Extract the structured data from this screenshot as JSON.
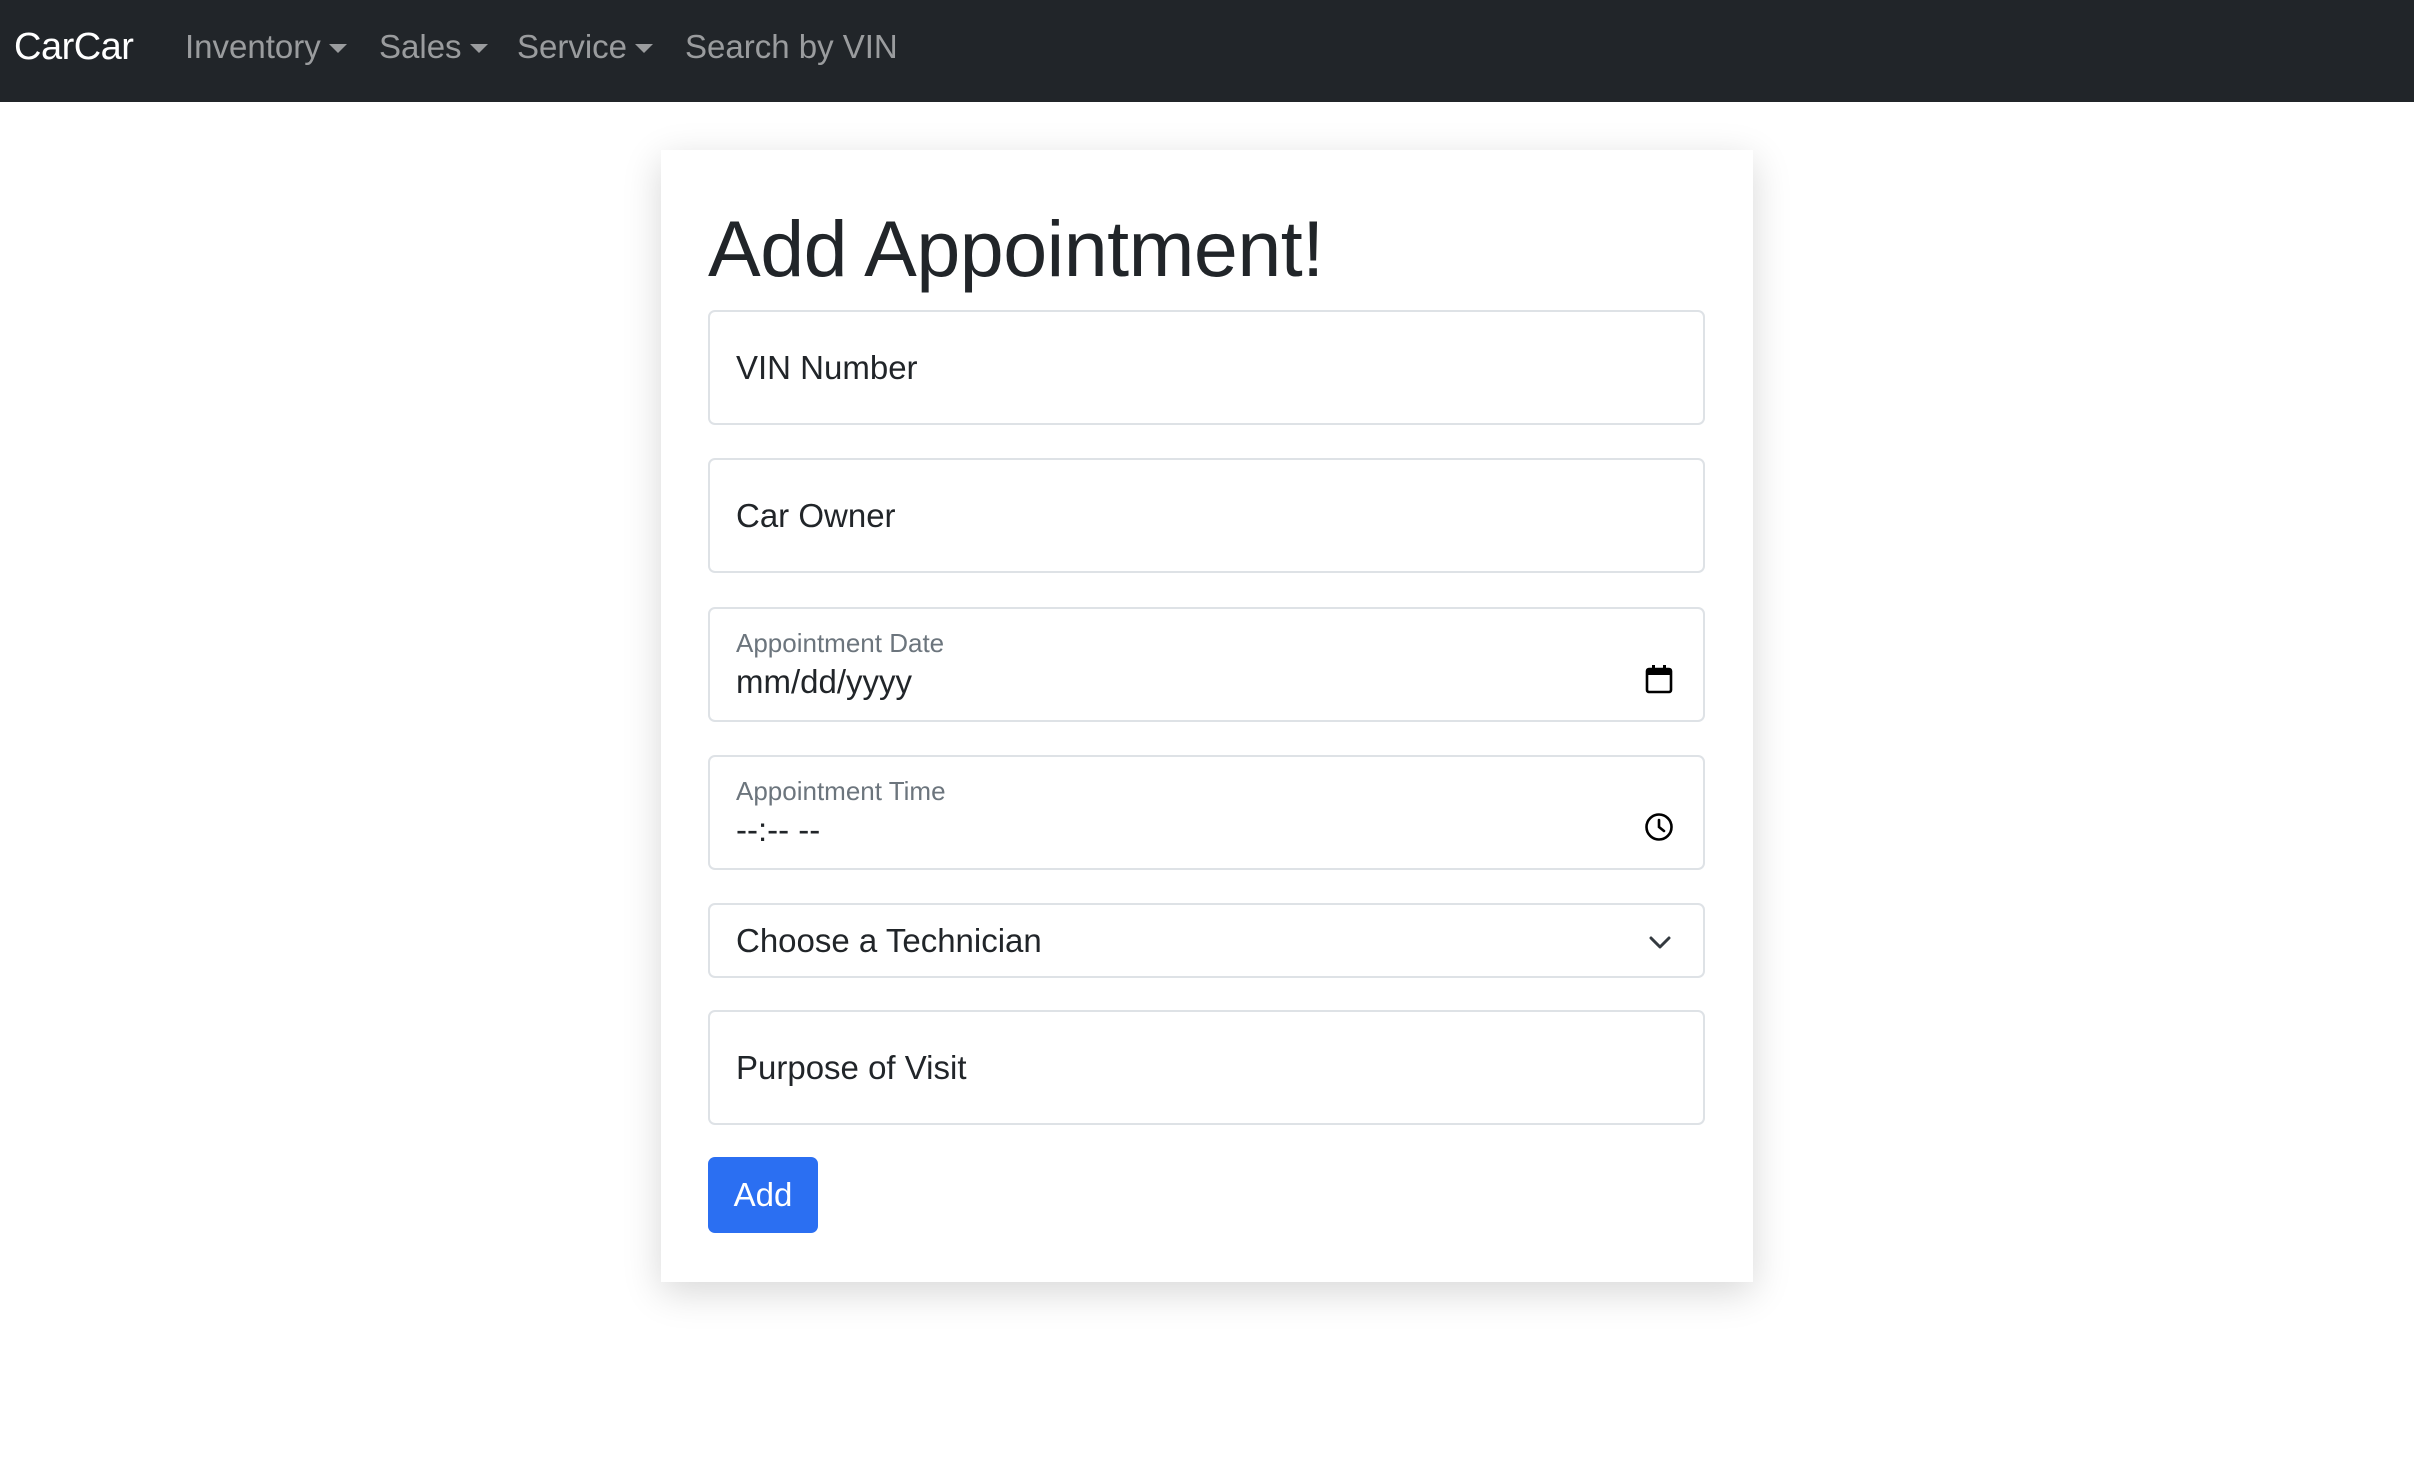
{
  "navbar": {
    "brand": "CarCar",
    "items": [
      {
        "label": "Inventory",
        "dropdown": true
      },
      {
        "label": "Sales",
        "dropdown": true
      },
      {
        "label": "Service",
        "dropdown": true
      },
      {
        "label": "Search by VIN",
        "dropdown": false
      }
    ]
  },
  "form": {
    "title": "Add Appointment!",
    "vin": {
      "placeholder": "VIN Number",
      "value": ""
    },
    "owner": {
      "placeholder": "Car Owner",
      "value": ""
    },
    "date": {
      "label": "Appointment Date",
      "value": "mm/dd/yyyy",
      "icon": "calendar-icon"
    },
    "time": {
      "label": "Appointment Time",
      "value": "--:-- --",
      "icon": "clock-icon"
    },
    "technician": {
      "selected": "Choose a Technician",
      "icon": "chevron-down-icon"
    },
    "purpose": {
      "placeholder": "Purpose of Visit",
      "value": ""
    },
    "submit_label": "Add"
  },
  "colors": {
    "navbar_bg": "#212529",
    "primary_button": "#2b6ff2",
    "field_border": "#dee2e6"
  }
}
